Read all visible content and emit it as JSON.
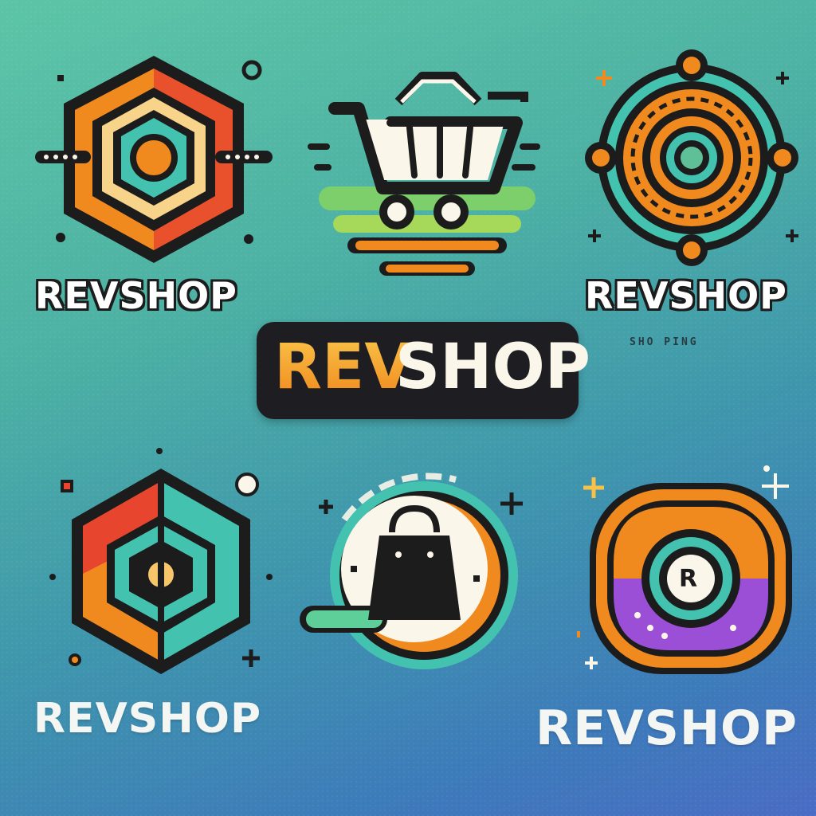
{
  "logos": [
    {
      "id": "logo-1",
      "wordmark": "REVSHOP",
      "icon": "hexagon-target-icon"
    },
    {
      "id": "logo-2",
      "icon": "shopping-cart-icon"
    },
    {
      "id": "logo-3",
      "wordmark": "REVSHOP",
      "tagline": "SHO PING",
      "icon": "concentric-circle-icon"
    },
    {
      "id": "logo-center",
      "wordmark_part1": "REV",
      "wordmark_part2": "SHOP"
    },
    {
      "id": "logo-4",
      "wordmark": "REVSHOP",
      "icon": "split-hexagon-icon"
    },
    {
      "id": "logo-5",
      "icon": "shopping-bag-icon"
    },
    {
      "id": "logo-6",
      "wordmark": "REVSHOP",
      "icon": "r-badge-icon",
      "badge_letter": "R"
    }
  ],
  "colors": {
    "dark": "#1c1c1c",
    "orange": "#f08a1f",
    "red": "#e8452f",
    "teal": "#43c2b0",
    "purple": "#9b4fd6",
    "cream": "#fbf6ea"
  }
}
